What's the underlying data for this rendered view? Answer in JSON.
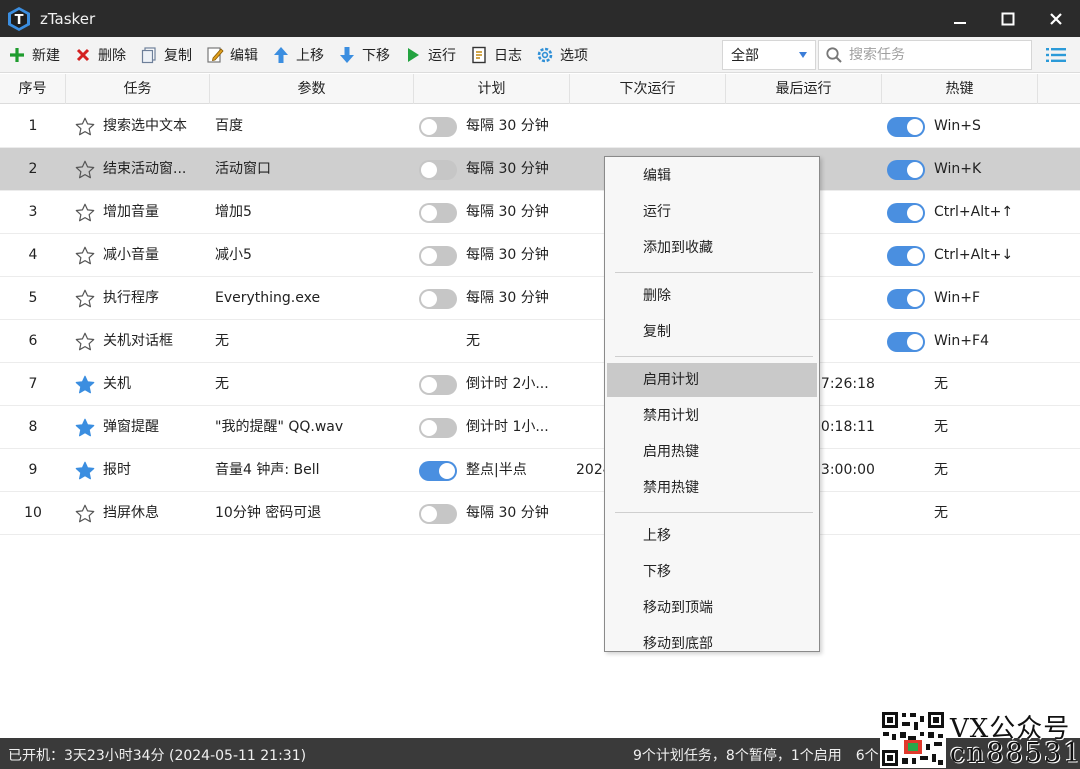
{
  "window": {
    "title": "zTasker",
    "icon_letter": "T",
    "accent": "#3b7dd8"
  },
  "toolbar": {
    "new_label": "新建",
    "delete_label": "删除",
    "copy_label": "复制",
    "edit_label": "编辑",
    "up_label": "上移",
    "down_label": "下移",
    "run_label": "运行",
    "log_label": "日志",
    "options_label": "选项",
    "filter_value": "全部",
    "search_placeholder": "搜索任务"
  },
  "columns": {
    "no": "序号",
    "task": "任务",
    "param": "参数",
    "plan": "计划",
    "next_run": "下次运行",
    "last_run": "最后运行",
    "hotkey": "热键"
  },
  "rows": [
    {
      "no": "1",
      "starred": false,
      "task": "搜索选中文本",
      "param": "百度",
      "plan_toggle": "off",
      "plan": "每隔 30 分钟",
      "next_run": "",
      "last_run": "",
      "hotkey_toggle": "on",
      "hotkey": "Win+S",
      "selected": false
    },
    {
      "no": "2",
      "starred": false,
      "task": "结束活动窗...",
      "param": "活动窗口",
      "plan_toggle": "off",
      "plan": "每隔 30 分钟",
      "next_run": "",
      "last_run": "",
      "hotkey_toggle": "on",
      "hotkey": "Win+K",
      "selected": true
    },
    {
      "no": "3",
      "starred": false,
      "task": "增加音量",
      "param": "增加5",
      "plan_toggle": "off",
      "plan": "每隔 30 分钟",
      "next_run": "",
      "last_run": "",
      "hotkey_toggle": "on",
      "hotkey": "Ctrl+Alt+↑",
      "selected": false
    },
    {
      "no": "4",
      "starred": false,
      "task": "减小音量",
      "param": "减小5",
      "plan_toggle": "off",
      "plan": "每隔 30 分钟",
      "next_run": "",
      "last_run": "",
      "hotkey_toggle": "on",
      "hotkey": "Ctrl+Alt+↓",
      "selected": false
    },
    {
      "no": "5",
      "starred": false,
      "task": "执行程序",
      "param": "Everything.exe",
      "plan_toggle": "off",
      "plan": "每隔 30 分钟",
      "next_run": "",
      "last_run": "",
      "hotkey_toggle": "on",
      "hotkey": "Win+F",
      "selected": false
    },
    {
      "no": "6",
      "starred": false,
      "task": "关机对话框",
      "param": "无",
      "plan_toggle": "none",
      "plan": "无",
      "next_run": "",
      "last_run": "",
      "hotkey_toggle": "on",
      "hotkey": "Win+F4",
      "selected": false
    },
    {
      "no": "7",
      "starred": true,
      "task": "关机",
      "param": "无",
      "plan_toggle": "off",
      "plan": "倒计时 2小...",
      "next_run": "",
      "last_run": "07:26:18",
      "hotkey_toggle": "none",
      "hotkey": "无",
      "selected": false
    },
    {
      "no": "8",
      "starred": true,
      "task": "弹窗提醒",
      "param": "\"我的提醒\" QQ.wav",
      "plan_toggle": "off",
      "plan": "倒计时 1小...",
      "next_run": "",
      "last_run": "10:18:11",
      "hotkey_toggle": "none",
      "hotkey": "无",
      "selected": false
    },
    {
      "no": "9",
      "starred": true,
      "task": "报时",
      "param": "音量4 钟声: Bell",
      "plan_toggle": "on",
      "plan": "整点|半点",
      "next_run": "2024",
      "last_run": "03:00:00",
      "hotkey_toggle": "none",
      "hotkey": "无",
      "selected": false
    },
    {
      "no": "10",
      "starred": false,
      "task": "挡屏休息",
      "param": "10分钟 密码可退",
      "plan_toggle": "off",
      "plan": "每隔 30 分钟",
      "next_run": "",
      "last_run": "",
      "hotkey_toggle": "none",
      "hotkey": "无",
      "selected": false
    }
  ],
  "context_menu": {
    "items": [
      {
        "label": "编辑",
        "hover": false
      },
      {
        "label": "运行",
        "hover": false
      },
      {
        "label": "添加到收藏",
        "hover": false
      },
      {
        "label": "删除",
        "hover": false
      },
      {
        "label": "复制",
        "hover": false
      },
      {
        "label": "启用计划",
        "hover": true
      },
      {
        "label": "禁用计划",
        "hover": false
      },
      {
        "label": "启用热键",
        "hover": false
      },
      {
        "label": "禁用热键",
        "hover": false
      },
      {
        "label": "上移",
        "hover": false
      },
      {
        "label": "下移",
        "hover": false
      },
      {
        "label": "移动到顶端",
        "hover": false
      },
      {
        "label": "移动到底部",
        "hover": false
      }
    ]
  },
  "status": {
    "left": "已开机：3天23小时34分 (2024-05-11 21:31)",
    "right": "9个计划任务，8个暂停，1个启用　6个"
  },
  "watermark": {
    "line1": "VX公众号",
    "line2": "cn88531"
  },
  "colors": {
    "titlebar": "#2b2b2b",
    "toggle_on": "#4a8fe0",
    "toggle_off": "#c6c6c6",
    "star_filled": "#3b8ee0",
    "selected_row": "#cfcfcf",
    "statusbar": "#3a3a3a"
  }
}
